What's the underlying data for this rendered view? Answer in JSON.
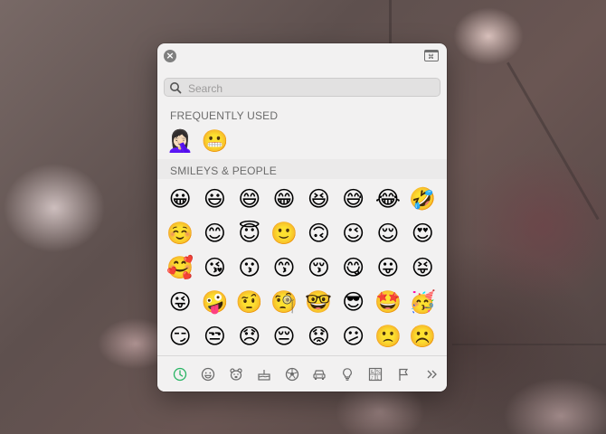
{
  "picker": {
    "search_placeholder": "Search",
    "sections": {
      "frequently_used": "FREQUENTLY USED",
      "smileys_people": "SMILEYS & PEOPLE"
    },
    "frequent_emojis": [
      "🤦🏻‍♀️",
      "😬"
    ],
    "smileys_rows": [
      [
        "😀",
        "😃",
        "😄",
        "😁",
        "😆",
        "😅",
        "😂",
        "🤣"
      ],
      [
        "☺️",
        "😊",
        "😇",
        "🙂",
        "🙃",
        "😉",
        "😌",
        "😍"
      ],
      [
        "🥰",
        "😘",
        "😗",
        "😙",
        "😚",
        "😋",
        "😛",
        "😝"
      ],
      [
        "😜",
        "🤪",
        "🤨",
        "🧐",
        "🤓",
        "😎",
        "🤩",
        "🥳"
      ],
      [
        "😏",
        "😒",
        "😞",
        "😔",
        "😟",
        "😕",
        "🙁",
        "☹️"
      ],
      [
        "😣",
        "😖",
        "😫",
        "😩",
        "🥺",
        "😢",
        "😭",
        "😤"
      ]
    ],
    "categories": [
      {
        "name": "frequently-used",
        "icon": "clock-icon",
        "active": true
      },
      {
        "name": "smileys-people",
        "icon": "smiley-icon"
      },
      {
        "name": "animals-nature",
        "icon": "bear-icon"
      },
      {
        "name": "food-drink",
        "icon": "cake-icon"
      },
      {
        "name": "activity",
        "icon": "soccer-ball-icon"
      },
      {
        "name": "travel-places",
        "icon": "car-icon"
      },
      {
        "name": "objects",
        "icon": "lightbulb-icon"
      },
      {
        "name": "symbols",
        "icon": "symbols-icon"
      },
      {
        "name": "flags",
        "icon": "flag-icon"
      },
      {
        "name": "more",
        "icon": "double-chevron-icon"
      }
    ],
    "accent_color": "#28b463"
  }
}
